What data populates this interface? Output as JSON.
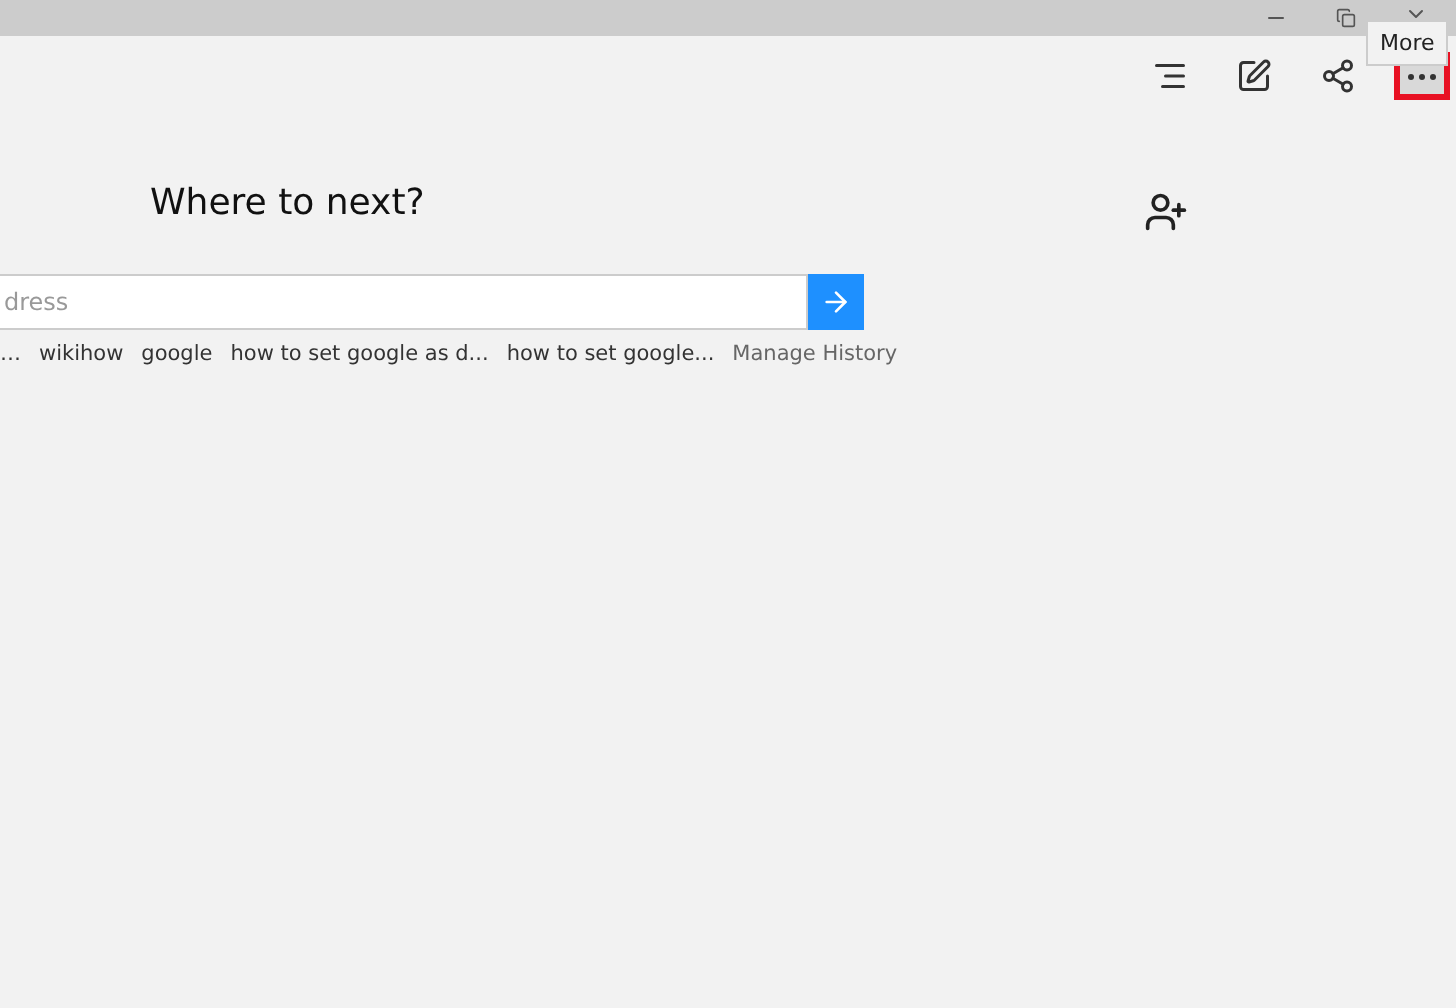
{
  "toolbar": {
    "more_tooltip": "More",
    "more_highlighted": true
  },
  "heading": "Where to next?",
  "search": {
    "placeholder": "dress"
  },
  "suggestions": [
    "…",
    "wikihow",
    "google",
    "how to set google as d...",
    "how to set google..."
  ],
  "manage_history": "Manage History"
}
